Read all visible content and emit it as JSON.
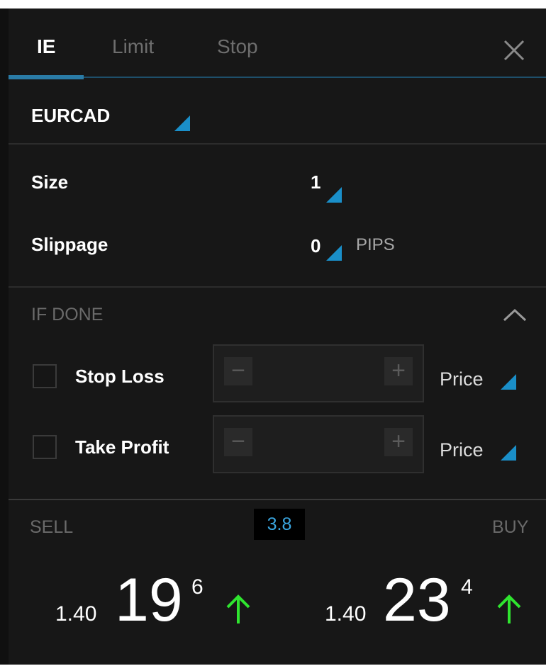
{
  "tabs": [
    {
      "label": "IE",
      "active": true
    },
    {
      "label": "Limit",
      "active": false
    },
    {
      "label": "Stop",
      "active": false
    }
  ],
  "instrument": {
    "symbol": "EURCAD"
  },
  "order": {
    "size_label": "Size",
    "size_value": "1",
    "slippage_label": "Slippage",
    "slippage_value": "0",
    "slippage_unit": "PIPS"
  },
  "if_done": {
    "title": "IF DONE",
    "stop_loss": {
      "label": "Stop Loss",
      "price_mode": "Price",
      "checked": false
    },
    "take_profit": {
      "label": "Take Profit",
      "price_mode": "Price",
      "checked": false
    },
    "minus_symbol": "−",
    "plus_symbol": "+"
  },
  "quote": {
    "spread": "3.8",
    "sell_label": "SELL",
    "buy_label": "BUY",
    "sell": {
      "prefix": "1.40",
      "big": "19",
      "pip": "6"
    },
    "buy": {
      "prefix": "1.40",
      "big": "23",
      "pip": "4"
    }
  },
  "colors": {
    "accent": "#1a8fc9",
    "up_arrow": "#2fe52f",
    "background": "#171717"
  },
  "icons": [
    "close-icon",
    "chevron-up-icon",
    "arrow-up-icon"
  ]
}
